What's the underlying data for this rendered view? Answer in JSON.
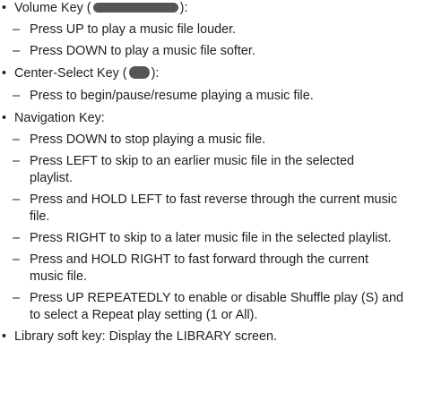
{
  "items": {
    "volume_pre": "Volume Key (",
    "volume_post": "):",
    "vol_up": "Press UP to play a music file louder.",
    "vol_down": "Press DOWN to play a music file softer.",
    "center_pre": "Center-Select Key (",
    "center_post": "):",
    "center_press": "Press to begin/pause/resume playing a music file.",
    "nav_title": "Navigation Key:",
    "nav_down": "Press DOWN to stop playing a music file.",
    "nav_left_1": "Press LEFT to skip to an earlier music file in the selected",
    "nav_left_2": "playlist.",
    "nav_hold_left_1": "Press and HOLD LEFT to fast reverse through the current music",
    "nav_hold_left_2": "file.",
    "nav_right": "Press RIGHT to skip to a later music file in the selected playlist.",
    "nav_hold_right_1": "Press and HOLD RIGHT to fast forward through the current",
    "nav_hold_right_2": "music file.",
    "nav_up_1": "Press UP REPEATEDLY to enable or disable Shuffle play (S) and",
    "nav_up_2": "to select a Repeat play setting (1 or All).",
    "library": "Library soft key: Display the LIBRARY screen."
  },
  "symbols": {
    "bullet": "•",
    "dash": "–"
  },
  "icons": {
    "volume_key": "volume-key-icon",
    "center_key": "center-select-key-icon"
  }
}
